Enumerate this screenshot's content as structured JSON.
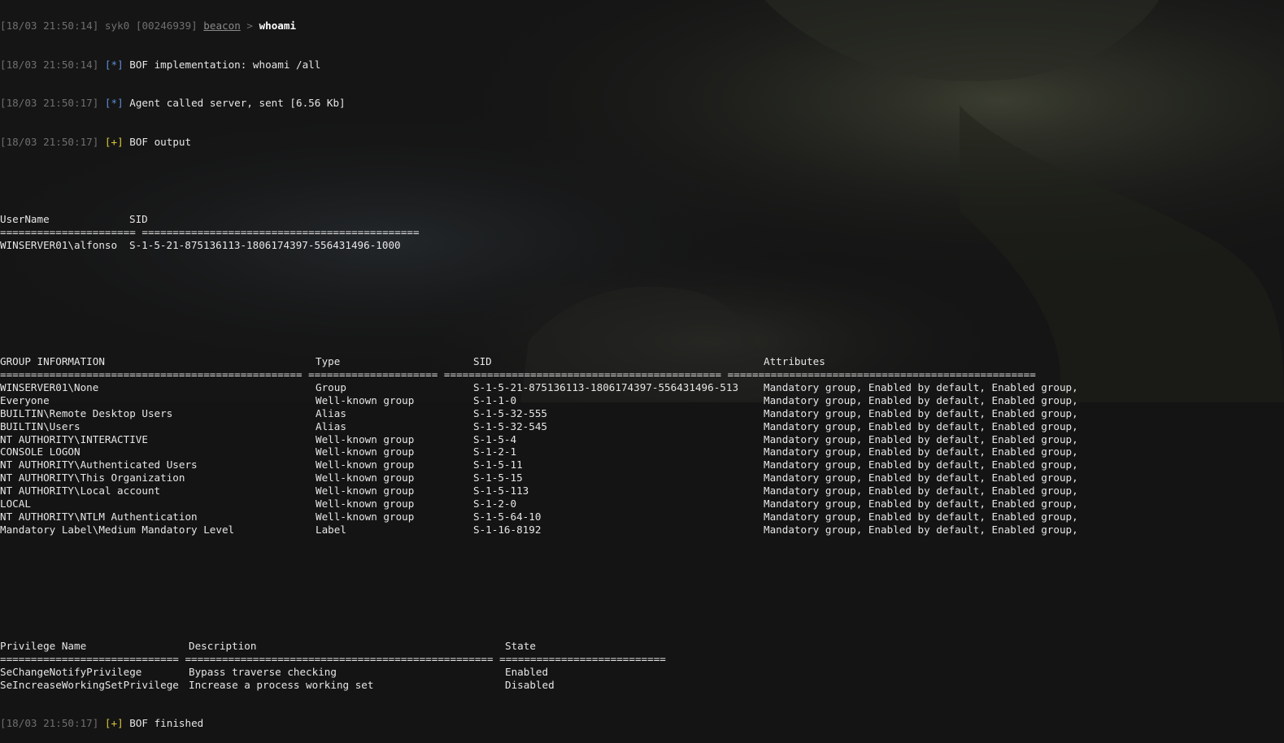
{
  "colors": {
    "background": "#141414",
    "text": "#e6e6e6",
    "timestamp": "#6f6f6f",
    "info_marker": "#5f8ed8",
    "success_marker": "#d8c83a"
  },
  "log": {
    "prompt": {
      "timestamp": "[18/03 21:50:14]",
      "user": "syk0",
      "pid": "[00246939]",
      "beacon": "beacon",
      "arrow": ">",
      "command": "whoami"
    },
    "lines": [
      {
        "timestamp": "[18/03 21:50:14]",
        "marker": "[*]",
        "text": "BOF implementation: whoami /all"
      },
      {
        "timestamp": "[18/03 21:50:17]",
        "marker": "[*]",
        "text": "Agent called server, sent [6.56 Kb]"
      },
      {
        "timestamp": "[18/03 21:50:17]",
        "marker": "[+]",
        "text": "BOF output"
      }
    ],
    "finished": {
      "timestamp": "[18/03 21:50:17]",
      "marker": "[+]",
      "text": "BOF finished"
    }
  },
  "user_table": {
    "headers": [
      "UserName",
      "SID"
    ],
    "separator": "====================== =============================================",
    "rows": [
      [
        "WINSERVER01\\alfonso",
        "S-1-5-21-875136113-1806174397-556431496-1000"
      ]
    ]
  },
  "group_table": {
    "headers": [
      "GROUP INFORMATION",
      "Type",
      "SID",
      "Attributes"
    ],
    "separator": "================================================= ===================== ============================================= ==================================================",
    "rows": [
      [
        "WINSERVER01\\None",
        "Group",
        "S-1-5-21-875136113-1806174397-556431496-513",
        "Mandatory group, Enabled by default, Enabled group,"
      ],
      [
        "Everyone",
        "Well-known group",
        "S-1-1-0",
        "Mandatory group, Enabled by default, Enabled group,"
      ],
      [
        "BUILTIN\\Remote Desktop Users",
        "Alias",
        "S-1-5-32-555",
        "Mandatory group, Enabled by default, Enabled group,"
      ],
      [
        "BUILTIN\\Users",
        "Alias",
        "S-1-5-32-545",
        "Mandatory group, Enabled by default, Enabled group,"
      ],
      [
        "NT AUTHORITY\\INTERACTIVE",
        "Well-known group",
        "S-1-5-4",
        "Mandatory group, Enabled by default, Enabled group,"
      ],
      [
        "CONSOLE LOGON",
        "Well-known group",
        "S-1-2-1",
        "Mandatory group, Enabled by default, Enabled group,"
      ],
      [
        "NT AUTHORITY\\Authenticated Users",
        "Well-known group",
        "S-1-5-11",
        "Mandatory group, Enabled by default, Enabled group,"
      ],
      [
        "NT AUTHORITY\\This Organization",
        "Well-known group",
        "S-1-5-15",
        "Mandatory group, Enabled by default, Enabled group,"
      ],
      [
        "NT AUTHORITY\\Local account",
        "Well-known group",
        "S-1-5-113",
        "Mandatory group, Enabled by default, Enabled group,"
      ],
      [
        "LOCAL",
        "Well-known group",
        "S-1-2-0",
        "Mandatory group, Enabled by default, Enabled group,"
      ],
      [
        "NT AUTHORITY\\NTLM Authentication",
        "Well-known group",
        "S-1-5-64-10",
        "Mandatory group, Enabled by default, Enabled group,"
      ],
      [
        "Mandatory Label\\Medium Mandatory Level",
        "Label",
        "S-1-16-8192",
        "Mandatory group, Enabled by default, Enabled group,"
      ]
    ]
  },
  "privilege_table": {
    "headers": [
      "Privilege Name",
      "Description",
      "State"
    ],
    "separator": "============================= ================================================== ===========================",
    "rows": [
      [
        "SeChangeNotifyPrivilege",
        "Bypass traverse checking",
        "Enabled"
      ],
      [
        "SeIncreaseWorkingSetPrivilege",
        "Increase a process working set",
        "Disabled"
      ]
    ]
  }
}
